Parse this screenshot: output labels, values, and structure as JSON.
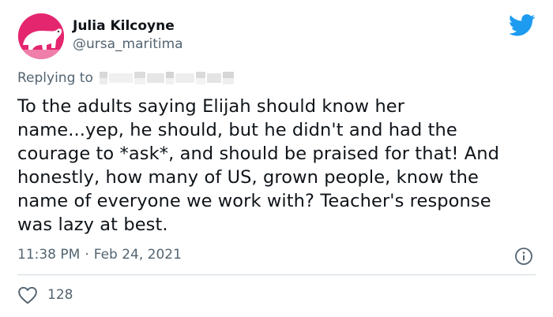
{
  "author": {
    "name": "Julia Kilcoyne",
    "handle": "@ursa_maritima"
  },
  "reply": {
    "label": "Replying to"
  },
  "tweet": {
    "lines": [
      "To the adults saying Elijah should know her",
      "name...yep, he should, but he didn't and had the",
      "courage to *ask*, and should be praised for that! And",
      "honestly, how many of US, grown people, know the",
      "name of everyone we work with? Teacher's response",
      "was lazy at best."
    ],
    "time": "11:38 PM",
    "separator": "·",
    "date": "Feb 24, 2021"
  },
  "stats": {
    "likes": "128"
  },
  "colors": {
    "avatar_bg": "#e4266f",
    "twitter_blue": "#1d9bf0",
    "secondary_text": "#536471"
  },
  "icons": [
    "twitter-bird-icon",
    "info-icon",
    "heart-icon"
  ]
}
